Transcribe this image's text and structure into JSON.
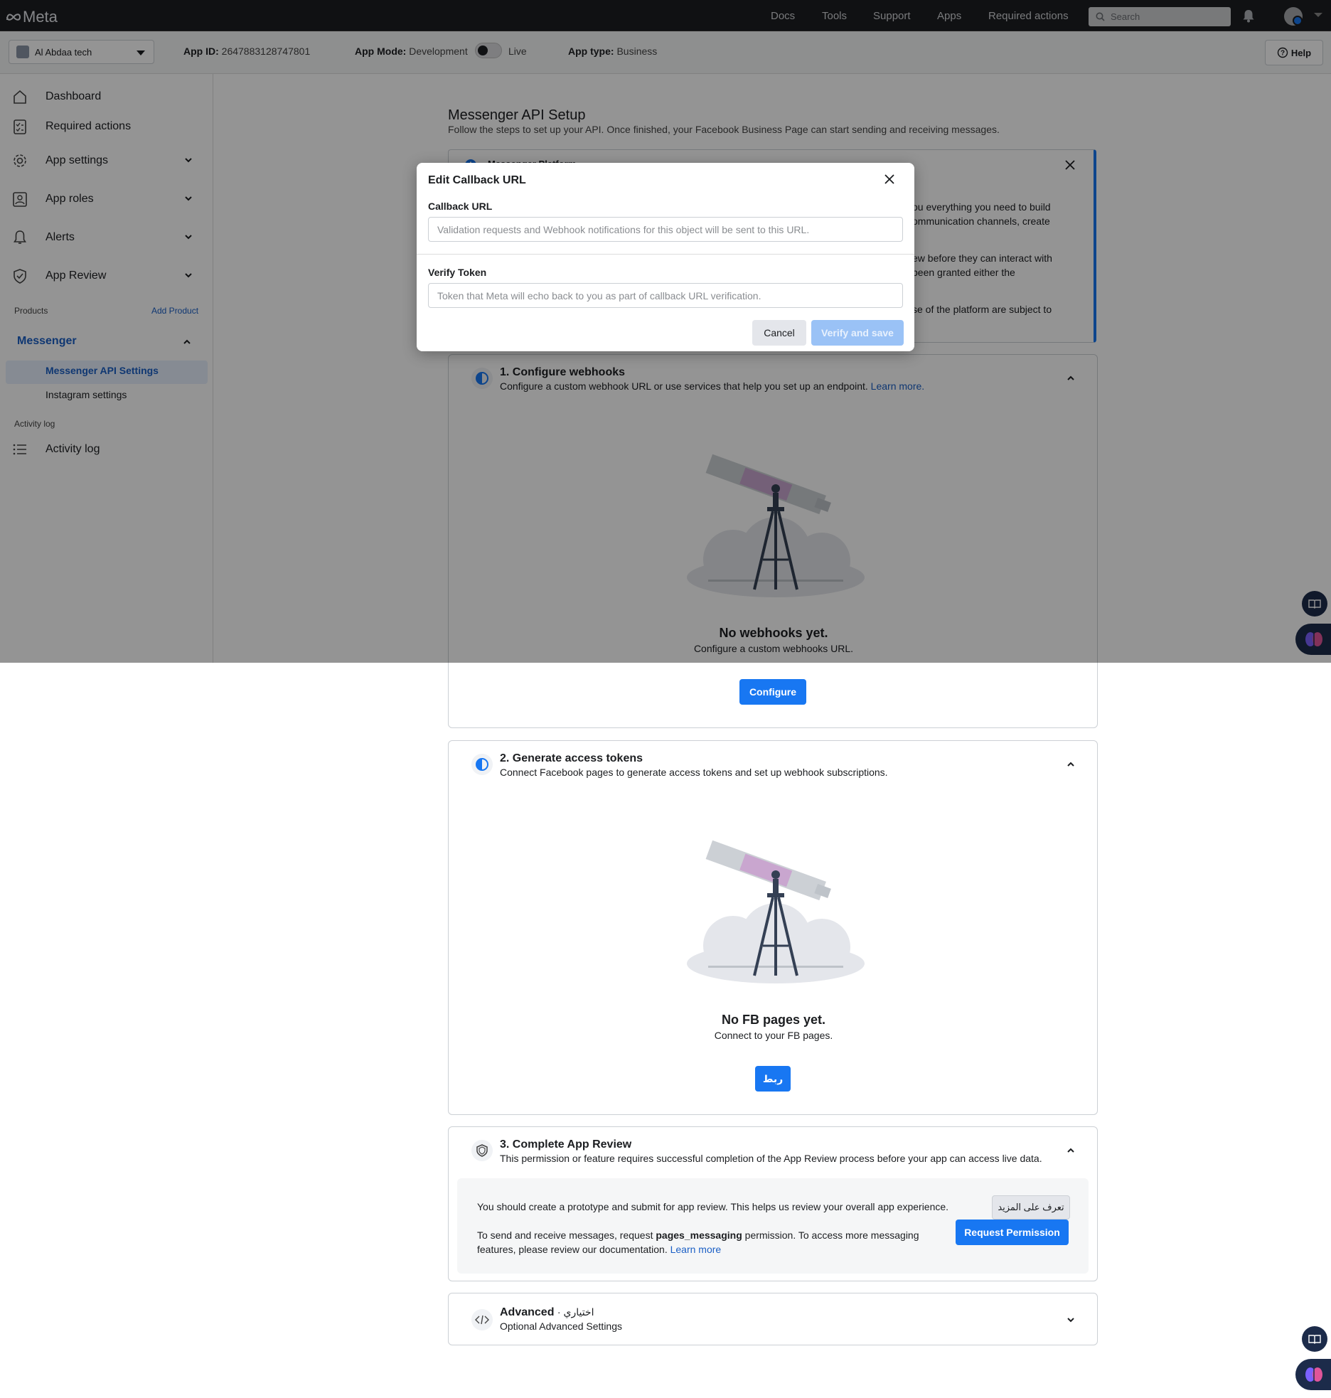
{
  "topbar": {
    "brand": "Meta",
    "nav": [
      "Docs",
      "Tools",
      "Support",
      "Apps",
      "Required actions"
    ],
    "search_placeholder": "Search"
  },
  "subbar": {
    "app_name": "Al Abdaa tech",
    "app_id_label": "App ID:",
    "app_id": "2647883128747801",
    "app_mode_label": "App Mode:",
    "app_mode": "Development",
    "live_label": "Live",
    "app_type_label": "App type:",
    "app_type": "Business",
    "help": "Help"
  },
  "sidebar": {
    "items": [
      {
        "label": "Dashboard",
        "icon": "home-icon"
      },
      {
        "label": "Required actions",
        "icon": "checklist-icon"
      },
      {
        "label": "App settings",
        "icon": "gear-icon"
      },
      {
        "label": "App roles",
        "icon": "user-badge-icon"
      },
      {
        "label": "Alerts",
        "icon": "bell-icon"
      },
      {
        "label": "App Review",
        "icon": "shield-check-icon"
      }
    ],
    "products_label": "Products",
    "add_product": "Add Product",
    "messenger": "Messenger",
    "messenger_sub": [
      "Messenger API Settings",
      "Instagram settings"
    ],
    "activity_section": "Activity log",
    "activity_item": "Activity log"
  },
  "main": {
    "title": "Messenger API Setup",
    "subtitle": "Follow the steps to set up your API. Once finished, your Facebook Business Page can start sending and receiving messages.",
    "banner": {
      "title": "Messenger Platform",
      "lines": [
        "ou everything you need to build",
        "ommunication channels, create",
        "ew before they can interact with",
        "been granted either the",
        "se of the platform are subject to"
      ]
    },
    "step1": {
      "title": "1. Configure webhooks",
      "subtitle": "Configure a custom webhook URL or use services that help you set up an endpoint.",
      "link": "Learn more.",
      "empty_title": "No webhooks yet.",
      "empty_sub": "Configure a custom webhooks URL.",
      "button": "Configure"
    },
    "step2": {
      "title": "2. Generate access tokens",
      "subtitle": "Connect Facebook pages to generate access tokens and set up webhook subscriptions.",
      "empty_title": "No FB pages yet.",
      "empty_sub": "Connect to your FB pages.",
      "button": "ربط"
    },
    "step3": {
      "title": "3. Complete App Review",
      "subtitle": "This permission or feature requires successful completion of the App Review process before your app can access live data.",
      "line1": "You should create a prototype and submit for app review. This helps us review your overall app experience.",
      "learn_more_ar": "تعرف على المزيد",
      "line2_a": "To send and receive messages, request ",
      "line2_bold": "pages_messaging",
      "line2_b": " permission. To access more messaging",
      "line3": "features, please review our documentation.",
      "line3_link": "Learn more",
      "button": "Request Permission"
    },
    "advanced": {
      "title": "Advanced",
      "title_suffix": "· اختياري",
      "subtitle": "Optional Advanced Settings"
    }
  },
  "modal": {
    "title": "Edit Callback URL",
    "callback_label": "Callback URL",
    "callback_placeholder": "Validation requests and Webhook notifications for this object will be sent to this URL.",
    "token_label": "Verify Token",
    "token_placeholder": "Token that Meta will echo back to you as part of callback URL verification.",
    "cancel": "Cancel",
    "verify": "Verify and save"
  }
}
